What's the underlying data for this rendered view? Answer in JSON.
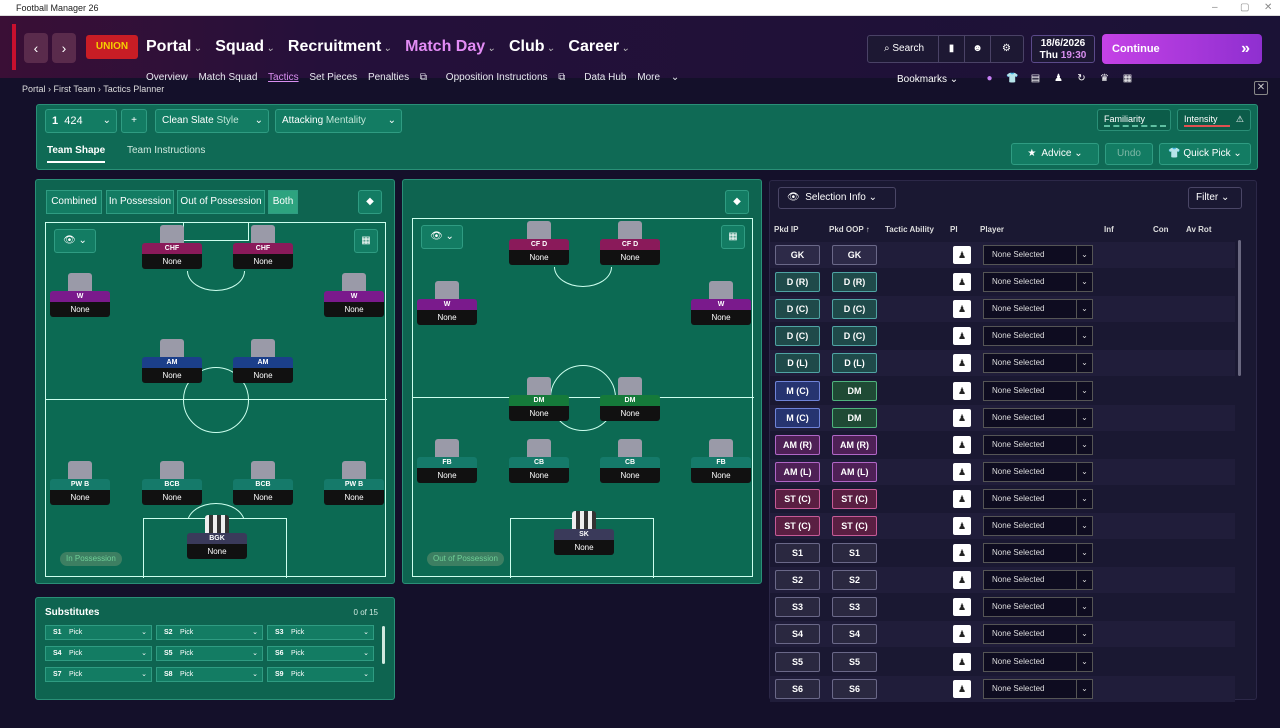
{
  "window": {
    "title": "Football Manager 26"
  },
  "header": {
    "nav": [
      "Portal",
      "Squad",
      "Recruitment",
      "Match Day",
      "Club",
      "Career"
    ],
    "subnav": [
      "Overview",
      "Match Squad",
      "Tactics",
      "Set Pieces",
      "Penalties",
      "Opposition Instructions",
      "Data Hub",
      "More"
    ],
    "search": "Search",
    "date": "18/6/2026",
    "day": "Thu",
    "time": "19:30",
    "continue": "Continue",
    "bookmarks": "Bookmarks",
    "club_crest": "UNION"
  },
  "breadcrumb": [
    "Portal",
    "First Team",
    "Tactics Planner"
  ],
  "tactic": {
    "slot": "1",
    "formation": "424",
    "style_name": "Clean Slate",
    "style_label": "Style",
    "mentality_name": "Attacking",
    "mentality_label": "Mentality",
    "familiarity": "Familiarity",
    "intensity": "Intensity",
    "tabs": [
      "Team Shape",
      "Team Instructions"
    ],
    "advice": "Advice",
    "undo": "Undo",
    "quick_pick": "Quick Pick"
  },
  "pitch_left": {
    "toggles": [
      "Combined",
      "In Possession",
      "Out of Possession",
      "Both"
    ],
    "tag": "In Possession",
    "players": [
      {
        "role": "CHF",
        "name": "None",
        "color": "#8a1a5a"
      },
      {
        "role": "CHF",
        "name": "None",
        "color": "#8a1a5a"
      },
      {
        "role": "W",
        "name": "None",
        "color": "#7a1a8c"
      },
      {
        "role": "W",
        "name": "None",
        "color": "#7a1a8c"
      },
      {
        "role": "AM",
        "name": "None",
        "color": "#1b3f8a"
      },
      {
        "role": "AM",
        "name": "None",
        "color": "#1b3f8a"
      },
      {
        "role": "PW B",
        "name": "None",
        "color": "#157a6a"
      },
      {
        "role": "BCB",
        "name": "None",
        "color": "#157a6a"
      },
      {
        "role": "BCB",
        "name": "None",
        "color": "#157a6a"
      },
      {
        "role": "PW B",
        "name": "None",
        "color": "#157a6a"
      },
      {
        "role": "BGK",
        "name": "None",
        "color": "#3a3a5a"
      }
    ]
  },
  "pitch_right": {
    "tag": "Out of Possession",
    "players": [
      {
        "role": "CF D",
        "name": "None",
        "color": "#8a1a5a"
      },
      {
        "role": "CF D",
        "name": "None",
        "color": "#8a1a5a"
      },
      {
        "role": "W",
        "name": "None",
        "color": "#7a1a8c"
      },
      {
        "role": "W",
        "name": "None",
        "color": "#7a1a8c"
      },
      {
        "role": "DM",
        "name": "None",
        "color": "#157a3a"
      },
      {
        "role": "DM",
        "name": "None",
        "color": "#157a3a"
      },
      {
        "role": "FB",
        "name": "None",
        "color": "#157a6a"
      },
      {
        "role": "CB",
        "name": "None",
        "color": "#157a6a"
      },
      {
        "role": "CB",
        "name": "None",
        "color": "#157a6a"
      },
      {
        "role": "FB",
        "name": "None",
        "color": "#157a6a"
      },
      {
        "role": "SK",
        "name": "None",
        "color": "#3a3a5a"
      }
    ]
  },
  "substitutes": {
    "title": "Substitutes",
    "count": "0 of 15",
    "slots": [
      {
        "k": "S1",
        "v": "Pick"
      },
      {
        "k": "S2",
        "v": "Pick"
      },
      {
        "k": "S3",
        "v": "Pick"
      },
      {
        "k": "S4",
        "v": "Pick"
      },
      {
        "k": "S5",
        "v": "Pick"
      },
      {
        "k": "S6",
        "v": "Pick"
      },
      {
        "k": "S7",
        "v": "Pick"
      },
      {
        "k": "S8",
        "v": "Pick"
      },
      {
        "k": "S9",
        "v": "Pick"
      }
    ]
  },
  "selection": {
    "info": "Selection Info",
    "filter": "Filter",
    "columns": [
      "Pkd IP",
      "Pkd OOP",
      "Tactic Ability",
      "PI",
      "Player",
      "Inf",
      "Con",
      "Av Rot"
    ],
    "rows": [
      {
        "ip": "GK",
        "oop": "GK",
        "player": "None Selected",
        "cls": "gk"
      },
      {
        "ip": "D (R)",
        "oop": "D (R)",
        "player": "None Selected",
        "cls": "d"
      },
      {
        "ip": "D (C)",
        "oop": "D (C)",
        "player": "None Selected",
        "cls": "d"
      },
      {
        "ip": "D (C)",
        "oop": "D (C)",
        "player": "None Selected",
        "cls": "d"
      },
      {
        "ip": "D (L)",
        "oop": "D (L)",
        "player": "None Selected",
        "cls": "d"
      },
      {
        "ip": "M (C)",
        "oop": "DM",
        "player": "None Selected",
        "cls": "m"
      },
      {
        "ip": "M (C)",
        "oop": "DM",
        "player": "None Selected",
        "cls": "m"
      },
      {
        "ip": "AM (R)",
        "oop": "AM (R)",
        "player": "None Selected",
        "cls": "am"
      },
      {
        "ip": "AM (L)",
        "oop": "AM (L)",
        "player": "None Selected",
        "cls": "am"
      },
      {
        "ip": "ST (C)",
        "oop": "ST (C)",
        "player": "None Selected",
        "cls": "st"
      },
      {
        "ip": "ST (C)",
        "oop": "ST (C)",
        "player": "None Selected",
        "cls": "st"
      },
      {
        "ip": "S1",
        "oop": "S1",
        "player": "None Selected",
        "cls": "s"
      },
      {
        "ip": "S2",
        "oop": "S2",
        "player": "None Selected",
        "cls": "s"
      },
      {
        "ip": "S3",
        "oop": "S3",
        "player": "None Selected",
        "cls": "s"
      },
      {
        "ip": "S4",
        "oop": "S4",
        "player": "None Selected",
        "cls": "s"
      },
      {
        "ip": "S5",
        "oop": "S5",
        "player": "None Selected",
        "cls": "s"
      },
      {
        "ip": "S6",
        "oop": "S6",
        "player": "None Selected",
        "cls": "s"
      }
    ]
  }
}
